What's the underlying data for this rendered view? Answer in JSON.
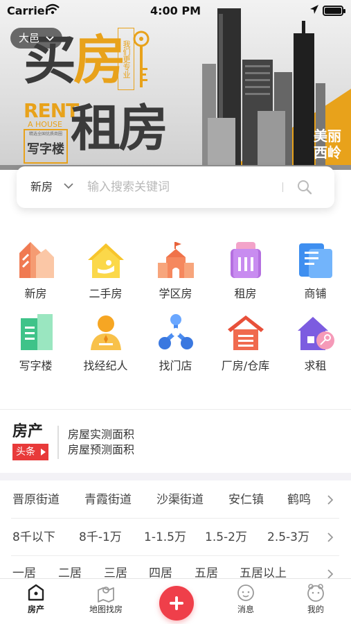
{
  "status_bar": {
    "carrier": "Carrier",
    "time": "4:00 PM"
  },
  "banner": {
    "city": "大邑",
    "title_a": "买",
    "title_b": "房",
    "tagline_vertical": "我们更专业",
    "rent_en_1": "RENT",
    "rent_en_2": "A HOUSE",
    "title_rent": "租房",
    "office_small": "精选全国优质商圈",
    "office_big": "写字楼",
    "corner_text_1": "美丽",
    "corner_text_2": "西岭",
    "accent_color": "#e8a21b"
  },
  "search": {
    "type_label": "新房",
    "placeholder": "输入搜索关键词"
  },
  "categories": [
    {
      "label": "新房",
      "icon": "new-house-icon"
    },
    {
      "label": "二手房",
      "icon": "second-hand-house-icon"
    },
    {
      "label": "学区房",
      "icon": "school-district-icon"
    },
    {
      "label": "租房",
      "icon": "rental-icon"
    },
    {
      "label": "商铺",
      "icon": "shop-icon"
    },
    {
      "label": "写字楼",
      "icon": "office-building-icon"
    },
    {
      "label": "找经纪人",
      "icon": "agent-icon"
    },
    {
      "label": "找门店",
      "icon": "store-icon"
    },
    {
      "label": "厂房/仓库",
      "icon": "warehouse-icon"
    },
    {
      "label": "求租",
      "icon": "seek-rental-icon"
    }
  ],
  "headlines": {
    "logo_top": "房产",
    "logo_bottom": "头条",
    "items": [
      "房屋实测面积",
      "房屋预测面积"
    ]
  },
  "filters": {
    "streets": [
      "晋原街道",
      "青霞街道",
      "沙渠街道",
      "安仁镇",
      "鹤鸣"
    ],
    "prices": [
      "8千以下",
      "8千-1万",
      "1-1.5万",
      "1.5-2万",
      "2.5-3万"
    ],
    "rooms": [
      "一居",
      "二居",
      "三居",
      "四居",
      "五居",
      "五居以上"
    ]
  },
  "tabbar": {
    "home": "房产",
    "map": "地图找房",
    "messages": "消息",
    "mine": "我的",
    "accent_color": "#ef3f4a"
  }
}
